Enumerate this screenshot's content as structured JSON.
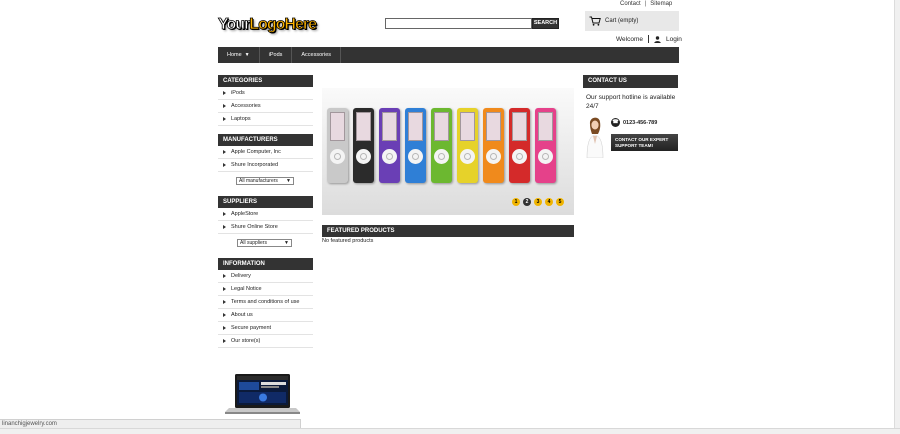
{
  "top_links": {
    "contact": "Contact",
    "separator": "|",
    "sitemap": "Sitemap"
  },
  "logo": {
    "part1": "Your",
    "part2": "LogoHere"
  },
  "search": {
    "placeholder": "",
    "button": "SEARCH"
  },
  "cart": {
    "label": "Cart (empty)",
    "icon": "cart-icon"
  },
  "account": {
    "welcome": "Welcome",
    "login": "Login",
    "icon": "user-icon"
  },
  "nav": {
    "items": [
      "Home",
      "iPods",
      "Accessories"
    ]
  },
  "categories": {
    "title": "CATEGORIES",
    "items": [
      "iPods",
      "Accessories",
      "Laptops"
    ]
  },
  "manufacturers": {
    "title": "MANUFACTURERS",
    "items": [
      "Apple Computer, Inc",
      "Shure Incorporated"
    ],
    "select": "All manufacturers"
  },
  "suppliers": {
    "title": "SUPPLIERS",
    "items": [
      "AppleStore",
      "Shure Online Store"
    ],
    "select": "All suppliers"
  },
  "information": {
    "title": "INFORMATION",
    "items": [
      "Delivery",
      "Legal Notice",
      "Terms and conditions of use",
      "About us",
      "Secure payment",
      "Our store(s)"
    ]
  },
  "slider": {
    "dots": [
      "1",
      "2",
      "3",
      "4",
      "5"
    ],
    "active_dot": 2,
    "ipod_colors": [
      "#c9c9c9",
      "#2b2b2b",
      "#6a3fb5",
      "#2f7fd6",
      "#6cb830",
      "#e6d22a",
      "#f08a1c",
      "#d42a2a",
      "#e5418a"
    ]
  },
  "featured": {
    "title": "FEATURED PRODUCTS",
    "text": "No featured products"
  },
  "contact": {
    "title": "CONTACT US",
    "hotline": "Our support hotline is available 24/7",
    "phone": "0123-456-789",
    "button": "CONTACT OUR EXPERT SUPPORT TEAM!"
  },
  "status": {
    "url": "linanchigjewelry.com"
  }
}
